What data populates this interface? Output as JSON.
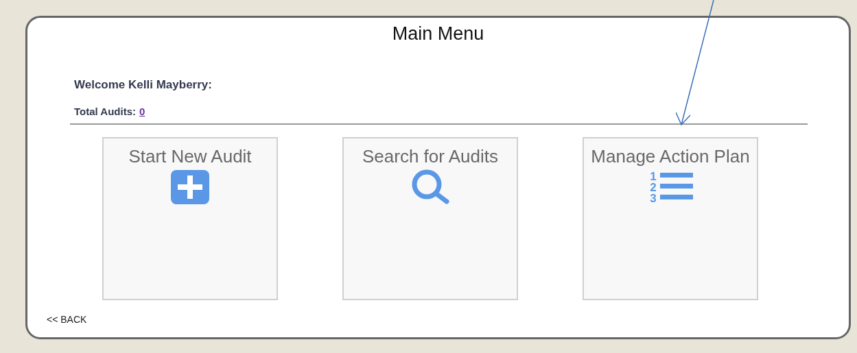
{
  "title": "Main Menu",
  "welcome": "Welcome Kelli Mayberry:",
  "total_audits": {
    "label": "Total Audits:",
    "value": "0"
  },
  "tiles": [
    {
      "label": "Start New Audit",
      "kind": "plus"
    },
    {
      "label": "Search for Audits",
      "kind": "search"
    },
    {
      "label": "Manage Action Plan",
      "kind": "list",
      "numbers": [
        "1",
        "2",
        "3"
      ]
    }
  ],
  "back": "<< BACK"
}
